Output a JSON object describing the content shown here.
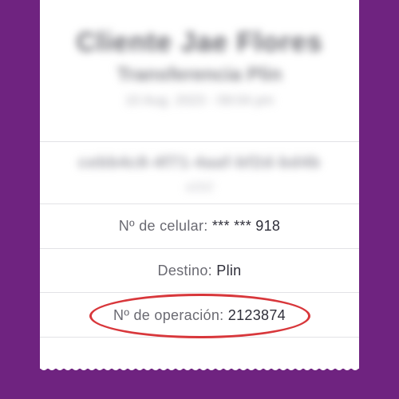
{
  "receipt": {
    "blurred_name": "Cliente Jae Flores",
    "blurred_subtitle": "Transferencia Plin",
    "blurred_date": "10 Aug. 2023 - 09:04 pm",
    "blurred_code": "cebb4c8-4f71-4aaf-bf2d-bd4b",
    "blurred_code_2": "a1b2",
    "phone_label": "Nº de celular:",
    "phone_value": "*** *** 918",
    "destination_label": "Destino:",
    "destination_value": "Plin",
    "operation_label": "Nº de operación:",
    "operation_value": "2123874"
  },
  "colors": {
    "background": "#6f2380",
    "highlight": "#d8373b"
  }
}
